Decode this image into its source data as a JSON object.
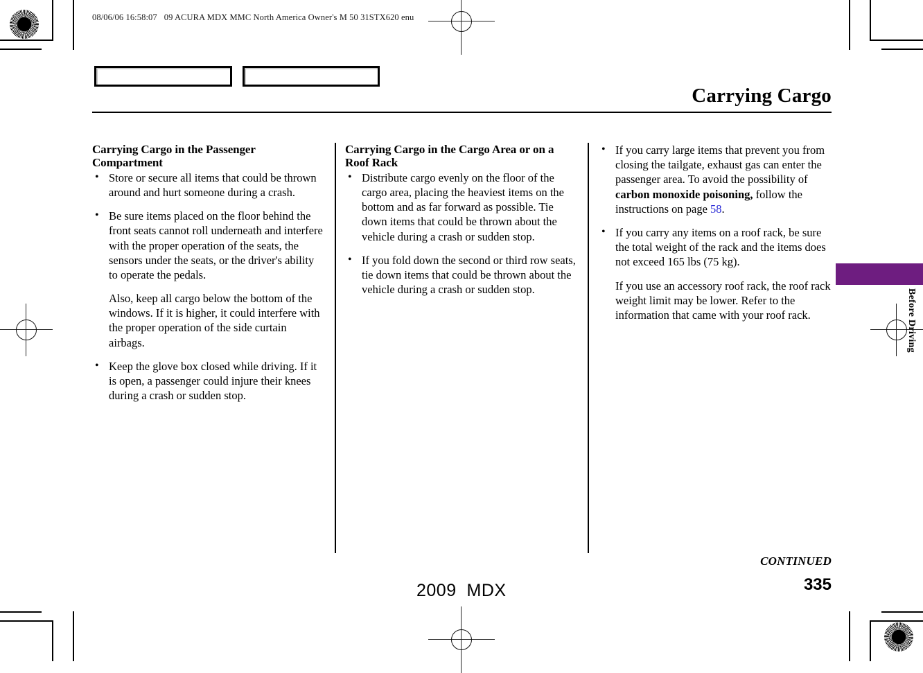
{
  "print_marks": {
    "burst_icon": "registration-burst-icon",
    "crosshair_icon": "registration-crosshair-icon"
  },
  "header": {
    "timestamp": "08/06/06 16:58:07",
    "job_info": "09 ACURA MDX MMC North America Owner's M 50 31STX620 enu"
  },
  "nav_boxes": [
    {
      "label": ""
    },
    {
      "label": ""
    }
  ],
  "chapter": {
    "title": "Carrying Cargo",
    "tab_label": "Before Driving",
    "tab_color": "#6E1D80"
  },
  "columns": {
    "col1": {
      "heading": "Carrying Cargo in the Passenger Compartment",
      "bullets": [
        {
          "text": "Store or secure all items that could be thrown around and hurt someone during a crash."
        },
        {
          "text": "Be sure items placed on the floor behind the front seats cannot roll underneath and interfere with the proper operation of the seats, the sensors under the seats, or the driver's ability to operate the pedals.",
          "continuation": "Also, keep all cargo below the bottom of the windows. If it is higher, it could interfere with the proper operation of the side curtain airbags."
        },
        {
          "text": "Keep the glove box closed while driving. If it is open, a passenger could injure their knees during a crash or sudden stop."
        }
      ]
    },
    "col2": {
      "heading": "Carrying Cargo in the Cargo Area or on a Roof Rack",
      "bullets": [
        {
          "text": "Distribute cargo evenly on the floor of the cargo area, placing the heaviest items on the bottom and as far forward as possible. Tie down items that could be thrown about the vehicle during a crash or sudden stop."
        },
        {
          "text": "If you fold down the second or third row seats, tie down items that could be thrown about the vehicle during a crash or sudden stop."
        }
      ]
    },
    "col3": {
      "bullets": [
        {
          "part1": "If you carry large items that prevent you from closing the tailgate, exhaust gas can enter the passenger area. To avoid the possibility of ",
          "bold": "carbon monoxide poisoning,",
          "part2": " follow the instructions on page ",
          "link": "58",
          "part3": "."
        },
        {
          "text": "If you carry any items on a roof rack, be sure the total weight of the rack and the items does not exceed 165 lbs (75 kg).",
          "continuation": "If you use an accessory roof rack, the roof rack weight limit may be lower. Refer to the information that came with your roof rack."
        }
      ]
    }
  },
  "footer": {
    "continued": "CONTINUED",
    "page_number": "335",
    "model_year": "2009",
    "model_name": "MDX"
  },
  "link_color": "#2b2bd6"
}
